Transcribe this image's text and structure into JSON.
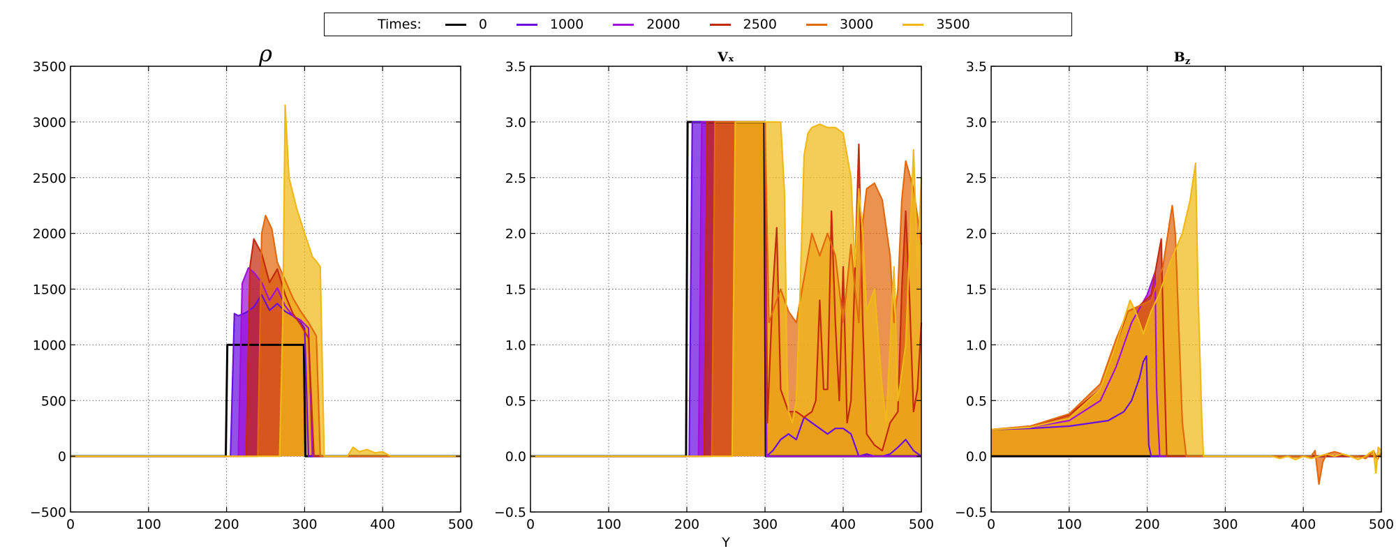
{
  "legend": {
    "title": "Times:",
    "entries": [
      {
        "label": "0",
        "color": "#000000"
      },
      {
        "label": "1000",
        "color": "#6a0ee0"
      },
      {
        "label": "2000",
        "color": "#a010d8"
      },
      {
        "label": "2500",
        "color": "#c42a0e"
      },
      {
        "label": "3000",
        "color": "#e2690e"
      },
      {
        "label": "3500",
        "color": "#f0b818"
      }
    ]
  },
  "chart_data": [
    {
      "type": "area",
      "title": "ρ",
      "xlabel": "",
      "ylabel": "",
      "xlim": [
        0,
        500
      ],
      "ylim": [
        -500,
        3500
      ],
      "xticks": [
        0,
        100,
        200,
        300,
        400,
        500
      ],
      "yticks": [
        -500,
        0,
        500,
        1000,
        1500,
        2000,
        2500,
        3000,
        3500
      ],
      "grid": true,
      "series": [
        {
          "name": "0",
          "color": "#000000",
          "fill": false,
          "x": [
            0,
            199,
            201,
            299,
            301,
            500
          ],
          "y": [
            0,
            0,
            1000,
            1000,
            0,
            0
          ]
        },
        {
          "name": "1000",
          "color": "#6a0ee0",
          "fill": true,
          "x": [
            0,
            205,
            210,
            215,
            225,
            235,
            245,
            255,
            265,
            275,
            285,
            295,
            300,
            305,
            500
          ],
          "y": [
            0,
            0,
            1280,
            1260,
            1290,
            1340,
            1450,
            1310,
            1370,
            1300,
            1260,
            1200,
            1150,
            0,
            0
          ]
        },
        {
          "name": "2000",
          "color": "#a010d8",
          "fill": true,
          "x": [
            0,
            215,
            220,
            228,
            235,
            245,
            255,
            265,
            275,
            285,
            295,
            305,
            310,
            500
          ],
          "y": [
            0,
            0,
            1550,
            1690,
            1650,
            1560,
            1400,
            1510,
            1350,
            1260,
            1220,
            1150,
            0,
            0
          ]
        },
        {
          "name": "2500",
          "color": "#c42a0e",
          "fill": true,
          "x": [
            0,
            225,
            230,
            235,
            245,
            255,
            265,
            275,
            285,
            295,
            305,
            312,
            500
          ],
          "y": [
            0,
            0,
            1700,
            1950,
            1820,
            1560,
            1680,
            1450,
            1280,
            1180,
            1060,
            0,
            0
          ]
        },
        {
          "name": "3000",
          "color": "#e2690e",
          "fill": true,
          "x": [
            0,
            240,
            245,
            250,
            258,
            265,
            275,
            285,
            295,
            305,
            315,
            320,
            500
          ],
          "y": [
            0,
            0,
            2000,
            2160,
            2040,
            1740,
            1580,
            1420,
            1300,
            1200,
            1080,
            0,
            0
          ]
        },
        {
          "name": "3500",
          "color": "#f0b818",
          "fill": true,
          "x": [
            0,
            268,
            272,
            275,
            280,
            290,
            300,
            310,
            315,
            320,
            325,
            355,
            362,
            370,
            380,
            390,
            400,
            410,
            500
          ],
          "y": [
            0,
            0,
            1200,
            3150,
            2500,
            2220,
            2000,
            1790,
            1750,
            1700,
            0,
            0,
            80,
            40,
            60,
            30,
            40,
            0,
            0
          ]
        }
      ]
    },
    {
      "type": "area",
      "title": "Vₓ",
      "xlabel": "Y",
      "ylabel": "",
      "xlim": [
        0,
        500
      ],
      "ylim": [
        -0.5,
        3.5
      ],
      "xticks": [
        0,
        100,
        200,
        300,
        400,
        500
      ],
      "yticks": [
        -0.5,
        0.0,
        0.5,
        1.0,
        1.5,
        2.0,
        2.5,
        3.0,
        3.5
      ],
      "grid": true,
      "series": [
        {
          "name": "0",
          "color": "#000000",
          "fill": false,
          "x": [
            0,
            199,
            201,
            299,
            301,
            500
          ],
          "y": [
            0,
            0,
            3.0,
            3.0,
            0,
            0
          ]
        },
        {
          "name": "1000",
          "color": "#6a0ee0",
          "fill": true,
          "x": [
            0,
            203,
            207,
            300,
            302,
            310,
            320,
            330,
            340,
            350,
            360,
            370,
            380,
            390,
            400,
            410,
            420,
            430,
            440,
            450,
            460,
            470,
            480,
            490,
            500
          ],
          "y": [
            0,
            0,
            3.0,
            3.0,
            0,
            0.05,
            0.15,
            0.2,
            0.15,
            0.35,
            0.3,
            0.25,
            0.2,
            0.25,
            0.25,
            0.2,
            0.0,
            0.02,
            0.0,
            0.0,
            0.02,
            0.08,
            0.15,
            0.05,
            0.0
          ]
        },
        {
          "name": "2000",
          "color": "#a010d8",
          "fill": true,
          "x": [
            0,
            215,
            219,
            300,
            302,
            500
          ],
          "y": [
            0,
            0,
            3.0,
            3.0,
            0,
            0
          ]
        },
        {
          "name": "2500",
          "color": "#c42a0e",
          "fill": true,
          "x": [
            0,
            222,
            226,
            300,
            303,
            310,
            315,
            320,
            330,
            340,
            350,
            360,
            365,
            370,
            375,
            380,
            385,
            390,
            395,
            400,
            405,
            410,
            420,
            425,
            430,
            440,
            450,
            460,
            470,
            475,
            480,
            485,
            490,
            495,
            500
          ],
          "y": [
            0,
            0,
            3.0,
            3.0,
            0.3,
            1.5,
            2.05,
            0.6,
            0.4,
            0.4,
            0.35,
            0.4,
            0.5,
            1.4,
            0.6,
            0.6,
            2.2,
            1.2,
            0.5,
            1.7,
            0.3,
            0.5,
            2.8,
            1.2,
            0.2,
            0.1,
            0.05,
            0.3,
            0.4,
            1.5,
            2.2,
            1.4,
            0.4,
            0.6,
            1.2
          ]
        },
        {
          "name": "3000",
          "color": "#e2690e",
          "fill": true,
          "x": [
            0,
            232,
            236,
            300,
            305,
            310,
            320,
            330,
            340,
            350,
            360,
            370,
            380,
            390,
            400,
            410,
            415,
            420,
            425,
            430,
            440,
            450,
            460,
            465,
            470,
            475,
            480,
            490,
            500
          ],
          "y": [
            0,
            0,
            3.0,
            3.0,
            1.2,
            1.3,
            1.5,
            1.3,
            1.2,
            1.6,
            2.0,
            1.8,
            2.0,
            1.8,
            1.2,
            1.9,
            1.5,
            1.2,
            2.1,
            2.4,
            2.45,
            2.3,
            1.8,
            1.2,
            1.5,
            2.3,
            2.65,
            2.4,
            1.9
          ]
        },
        {
          "name": "3500",
          "color": "#f0b818",
          "fill": true,
          "x": [
            0,
            258,
            262,
            300,
            305,
            310,
            320,
            325,
            328,
            330,
            335,
            340,
            345,
            350,
            355,
            360,
            370,
            380,
            390,
            400,
            410,
            415,
            420,
            425,
            430,
            440,
            450,
            455,
            460,
            465,
            470,
            480,
            490,
            495,
            500
          ],
          "y": [
            0,
            0,
            3.0,
            3.0,
            3.0,
            3.0,
            3.0,
            2.35,
            0.8,
            0.4,
            0.3,
            0.5,
            1.5,
            2.7,
            2.9,
            2.95,
            2.98,
            2.95,
            2.95,
            2.9,
            2.5,
            1.7,
            2.4,
            2.0,
            1.3,
            1.5,
            0.6,
            0.3,
            1.0,
            1.7,
            0.5,
            1.0,
            2.75,
            1.7,
            2.5
          ]
        }
      ]
    },
    {
      "type": "area",
      "title": "B_z",
      "xlabel": "",
      "ylabel": "",
      "xlim": [
        0,
        500
      ],
      "ylim": [
        -0.5,
        3.5
      ],
      "xticks": [
        0,
        100,
        200,
        300,
        400,
        500
      ],
      "yticks": [
        -0.5,
        0.0,
        0.5,
        1.0,
        1.5,
        2.0,
        2.5,
        3.0,
        3.5
      ],
      "grid": true,
      "series": [
        {
          "name": "0",
          "color": "#000000",
          "fill": false,
          "x": [
            0,
            500
          ],
          "y": [
            0,
            0
          ]
        },
        {
          "name": "1000",
          "color": "#6a0ee0",
          "fill": true,
          "x": [
            0,
            50,
            100,
            150,
            170,
            180,
            190,
            195,
            199,
            200,
            202,
            205,
            500
          ],
          "y": [
            0.24,
            0.25,
            0.27,
            0.32,
            0.4,
            0.5,
            0.7,
            0.85,
            0.9,
            0.6,
            0.1,
            0,
            0
          ]
        },
        {
          "name": "2000",
          "color": "#a010d8",
          "fill": true,
          "x": [
            0,
            50,
            100,
            140,
            160,
            180,
            200,
            210,
            212,
            216,
            500
          ],
          "y": [
            0.24,
            0.26,
            0.32,
            0.5,
            0.8,
            1.2,
            1.45,
            1.65,
            0.6,
            0,
            0
          ]
        },
        {
          "name": "2500",
          "color": "#c42a0e",
          "fill": true,
          "x": [
            0,
            50,
            100,
            140,
            160,
            175,
            190,
            205,
            218,
            221,
            225,
            500
          ],
          "y": [
            0.24,
            0.27,
            0.37,
            0.6,
            1.0,
            1.3,
            1.35,
            1.45,
            1.95,
            1.0,
            0,
            0
          ]
        },
        {
          "name": "3000",
          "color": "#e2690e",
          "fill": true,
          "x": [
            0,
            50,
            100,
            140,
            160,
            175,
            190,
            205,
            220,
            232,
            236,
            245,
            250,
            400,
            410,
            415,
            420,
            425,
            430,
            440,
            450,
            460,
            470,
            480,
            490,
            495,
            500
          ],
          "y": [
            0.24,
            0.27,
            0.38,
            0.65,
            1.05,
            1.3,
            1.35,
            1.4,
            1.7,
            2.25,
            2.0,
            0.3,
            0,
            0,
            0,
            0.05,
            -0.25,
            -0.05,
            0.02,
            0.04,
            0.02,
            0,
            0,
            -0.02,
            0.05,
            -0.03,
            0.03
          ]
        },
        {
          "name": "3500",
          "color": "#f0b818",
          "fill": true,
          "x": [
            0,
            50,
            100,
            140,
            160,
            178,
            185,
            195,
            205,
            215,
            230,
            245,
            255,
            262,
            265,
            270,
            272,
            360,
            370,
            380,
            390,
            400,
            410,
            420,
            430,
            440,
            450,
            460,
            470,
            480,
            485,
            490,
            493,
            496,
            500
          ],
          "y": [
            0.24,
            0.26,
            0.34,
            0.6,
            1.0,
            1.4,
            1.3,
            1.1,
            1.3,
            1.45,
            1.75,
            2.0,
            2.3,
            2.63,
            1.5,
            0.3,
            0,
            0,
            -0.02,
            0.0,
            -0.03,
            0.0,
            -0.02,
            0.0,
            0.02,
            0.0,
            0.02,
            0.0,
            -0.03,
            0.0,
            0.03,
            0.05,
            -0.15,
            0.08,
            0.05
          ]
        }
      ]
    }
  ]
}
